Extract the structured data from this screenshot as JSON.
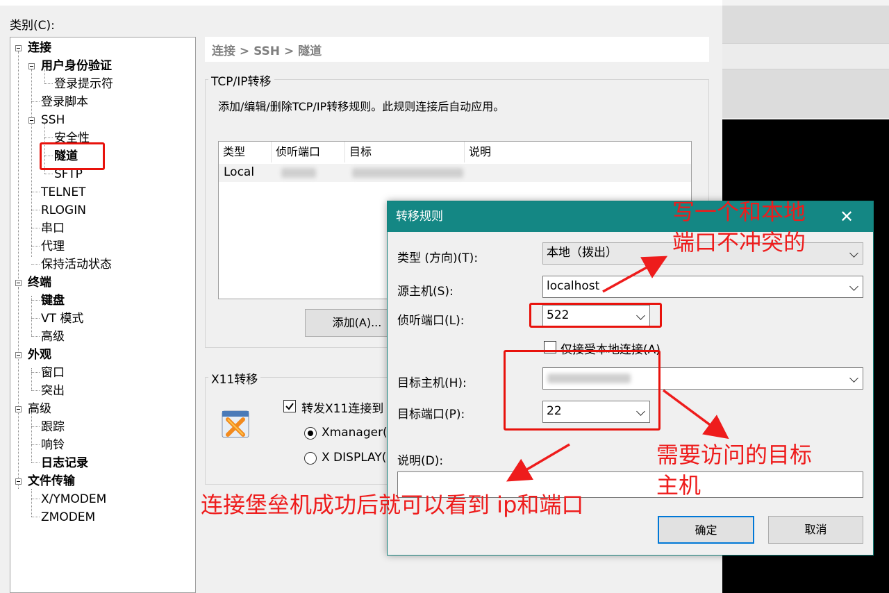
{
  "category": {
    "label": "类别(C):"
  },
  "tree": {
    "items": [
      {
        "label": "连接",
        "bold": true
      },
      {
        "label": "用户身份验证",
        "bold": true
      },
      {
        "label": "登录提示符"
      },
      {
        "label": "登录脚本"
      },
      {
        "label": "SSH"
      },
      {
        "label": "安全性"
      },
      {
        "label": "隧道",
        "bold": true,
        "selected": true
      },
      {
        "label": "SFTP"
      },
      {
        "label": "TELNET"
      },
      {
        "label": "RLOGIN"
      },
      {
        "label": "串口"
      },
      {
        "label": "代理"
      },
      {
        "label": "保持活动状态"
      },
      {
        "label": "终端",
        "bold": true
      },
      {
        "label": "键盘",
        "bold": true
      },
      {
        "label": "VT 模式"
      },
      {
        "label": "高级"
      },
      {
        "label": "外观",
        "bold": true
      },
      {
        "label": "窗口"
      },
      {
        "label": "突出"
      },
      {
        "label": "高级"
      },
      {
        "label": "跟踪"
      },
      {
        "label": "响铃"
      },
      {
        "label": "日志记录",
        "bold": true
      },
      {
        "label": "文件传输",
        "bold": true
      },
      {
        "label": "X/YMODEM"
      },
      {
        "label": "ZMODEM"
      }
    ]
  },
  "breadcrumb": "连接 > SSH > 隧道",
  "tcpip": {
    "title": "TCP/IP转移",
    "description": "添加/编辑/删除TCP/IP转移规则。此规则连接后自动应用。",
    "columns": [
      "类型",
      "侦听端口",
      "目标",
      "说明"
    ],
    "rows": [
      {
        "type": "Local"
      }
    ],
    "add_button": "添加(A)..."
  },
  "x11": {
    "title": "X11转移",
    "forward_checkbox": "转发X11连接到",
    "option_xmanager": "Xmanager(",
    "option_display": "X DISPLAY("
  },
  "rule_dialog": {
    "title": "转移规则",
    "close": "✕",
    "type_label": "类型 (方向)(T):",
    "type_value": "本地（拨出）",
    "source_label": "源主机(S):",
    "source_value": "localhost",
    "listen_label": "侦听端口(L):",
    "listen_value": "522",
    "local_only_label": "仅接受本地连接(A)",
    "target_host_label": "目标主机(H):",
    "target_port_label": "目标端口(P):",
    "target_port_value": "22",
    "desc_label": "说明(D):",
    "desc_value": "",
    "ok": "确定",
    "cancel": "取消"
  },
  "annotations": {
    "local_port_line1": "写一个和本地",
    "local_port_line2": "端口不冲突的",
    "target_line1": "需要访问的目标",
    "target_line2": "主机",
    "bastion": "连接堡垒机成功后就可以看到 ip和端口"
  },
  "colors": {
    "title_bar": "#148784",
    "annotation_red": "#ee1c1c"
  }
}
